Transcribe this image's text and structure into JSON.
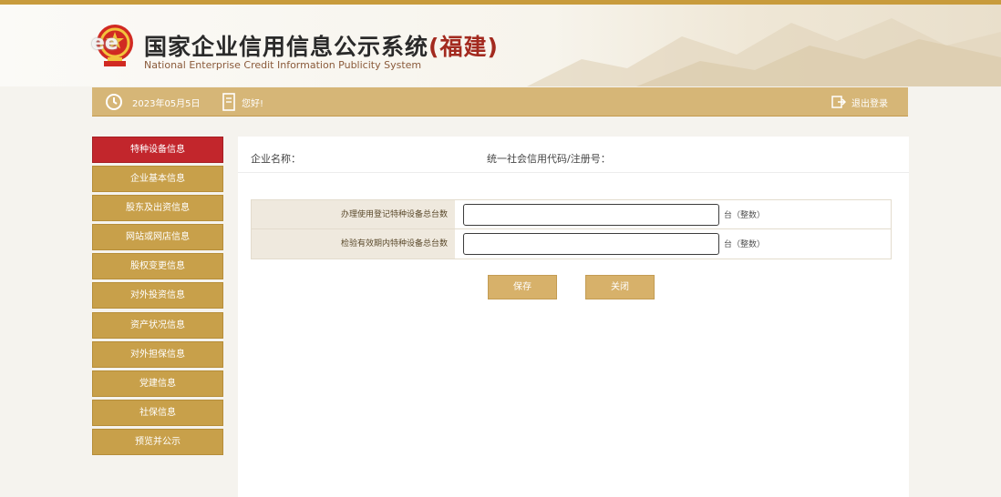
{
  "header": {
    "title_main": "国家企业信用信息公示系统",
    "title_province": "(福建)",
    "subtitle": "National Enterprise Credit Information Publicity System",
    "watermark": "ee"
  },
  "toolbar": {
    "date": "2023年05月5日",
    "greeting": "您好!",
    "logout_label": "退出登录"
  },
  "sidebar": {
    "items": [
      {
        "label": "特种设备信息",
        "active": true
      },
      {
        "label": "企业基本信息",
        "active": false
      },
      {
        "label": "股东及出资信息",
        "active": false
      },
      {
        "label": "网站或网店信息",
        "active": false
      },
      {
        "label": "股权变更信息",
        "active": false
      },
      {
        "label": "对外投资信息",
        "active": false
      },
      {
        "label": "资产状况信息",
        "active": false
      },
      {
        "label": "对外担保信息",
        "active": false
      },
      {
        "label": "党建信息",
        "active": false
      },
      {
        "label": "社保信息",
        "active": false
      },
      {
        "label": "预览并公示",
        "active": false
      }
    ]
  },
  "info": {
    "enterprise_name_label": "企业名称：",
    "credit_code_label": "统一社会信用代码/注册号："
  },
  "form": {
    "rows": [
      {
        "label": "办理使用登记特种设备总台数",
        "value": "",
        "unit": "台（整数）"
      },
      {
        "label": "检验有效期内特种设备总台数",
        "value": "",
        "unit": "台（整数）"
      }
    ]
  },
  "buttons": {
    "save": "保存",
    "close": "关闭"
  },
  "colors": {
    "accent_gold": "#c8a04a",
    "active_red": "#c2262c",
    "toolbar_gold": "#d6b677"
  }
}
